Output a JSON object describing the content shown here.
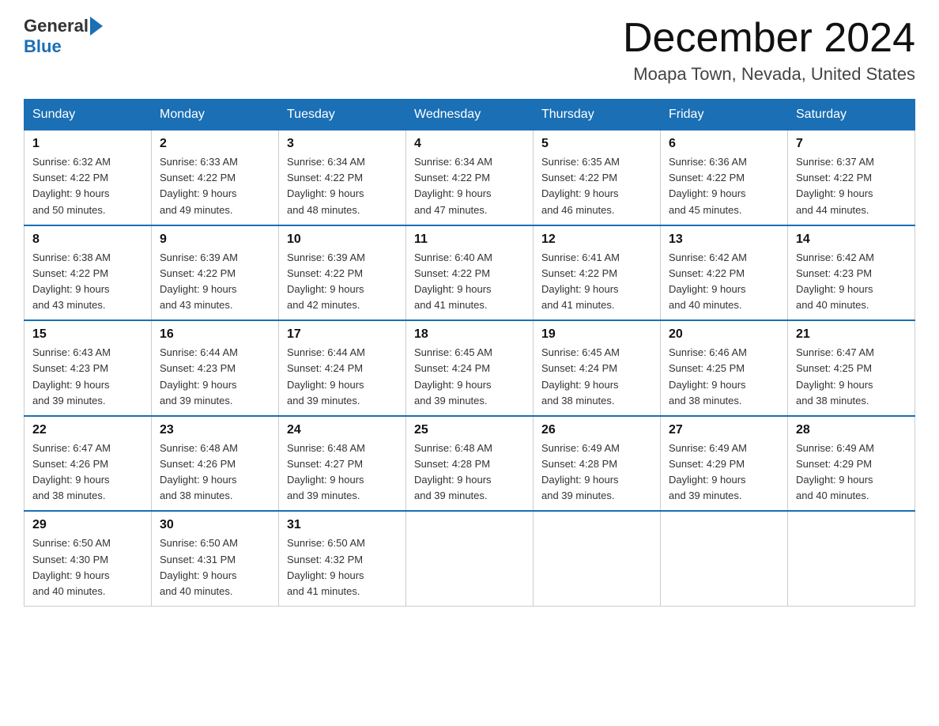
{
  "header": {
    "logo_general": "General",
    "logo_blue": "Blue",
    "month_title": "December 2024",
    "location": "Moapa Town, Nevada, United States"
  },
  "weekdays": [
    "Sunday",
    "Monday",
    "Tuesday",
    "Wednesday",
    "Thursday",
    "Friday",
    "Saturday"
  ],
  "weeks": [
    [
      {
        "day": "1",
        "sunrise": "6:32 AM",
        "sunset": "4:22 PM",
        "daylight": "9 hours and 50 minutes."
      },
      {
        "day": "2",
        "sunrise": "6:33 AM",
        "sunset": "4:22 PM",
        "daylight": "9 hours and 49 minutes."
      },
      {
        "day": "3",
        "sunrise": "6:34 AM",
        "sunset": "4:22 PM",
        "daylight": "9 hours and 48 minutes."
      },
      {
        "day": "4",
        "sunrise": "6:34 AM",
        "sunset": "4:22 PM",
        "daylight": "9 hours and 47 minutes."
      },
      {
        "day": "5",
        "sunrise": "6:35 AM",
        "sunset": "4:22 PM",
        "daylight": "9 hours and 46 minutes."
      },
      {
        "day": "6",
        "sunrise": "6:36 AM",
        "sunset": "4:22 PM",
        "daylight": "9 hours and 45 minutes."
      },
      {
        "day": "7",
        "sunrise": "6:37 AM",
        "sunset": "4:22 PM",
        "daylight": "9 hours and 44 minutes."
      }
    ],
    [
      {
        "day": "8",
        "sunrise": "6:38 AM",
        "sunset": "4:22 PM",
        "daylight": "9 hours and 43 minutes."
      },
      {
        "day": "9",
        "sunrise": "6:39 AM",
        "sunset": "4:22 PM",
        "daylight": "9 hours and 43 minutes."
      },
      {
        "day": "10",
        "sunrise": "6:39 AM",
        "sunset": "4:22 PM",
        "daylight": "9 hours and 42 minutes."
      },
      {
        "day": "11",
        "sunrise": "6:40 AM",
        "sunset": "4:22 PM",
        "daylight": "9 hours and 41 minutes."
      },
      {
        "day": "12",
        "sunrise": "6:41 AM",
        "sunset": "4:22 PM",
        "daylight": "9 hours and 41 minutes."
      },
      {
        "day": "13",
        "sunrise": "6:42 AM",
        "sunset": "4:22 PM",
        "daylight": "9 hours and 40 minutes."
      },
      {
        "day": "14",
        "sunrise": "6:42 AM",
        "sunset": "4:23 PM",
        "daylight": "9 hours and 40 minutes."
      }
    ],
    [
      {
        "day": "15",
        "sunrise": "6:43 AM",
        "sunset": "4:23 PM",
        "daylight": "9 hours and 39 minutes."
      },
      {
        "day": "16",
        "sunrise": "6:44 AM",
        "sunset": "4:23 PM",
        "daylight": "9 hours and 39 minutes."
      },
      {
        "day": "17",
        "sunrise": "6:44 AM",
        "sunset": "4:24 PM",
        "daylight": "9 hours and 39 minutes."
      },
      {
        "day": "18",
        "sunrise": "6:45 AM",
        "sunset": "4:24 PM",
        "daylight": "9 hours and 39 minutes."
      },
      {
        "day": "19",
        "sunrise": "6:45 AM",
        "sunset": "4:24 PM",
        "daylight": "9 hours and 38 minutes."
      },
      {
        "day": "20",
        "sunrise": "6:46 AM",
        "sunset": "4:25 PM",
        "daylight": "9 hours and 38 minutes."
      },
      {
        "day": "21",
        "sunrise": "6:47 AM",
        "sunset": "4:25 PM",
        "daylight": "9 hours and 38 minutes."
      }
    ],
    [
      {
        "day": "22",
        "sunrise": "6:47 AM",
        "sunset": "4:26 PM",
        "daylight": "9 hours and 38 minutes."
      },
      {
        "day": "23",
        "sunrise": "6:48 AM",
        "sunset": "4:26 PM",
        "daylight": "9 hours and 38 minutes."
      },
      {
        "day": "24",
        "sunrise": "6:48 AM",
        "sunset": "4:27 PM",
        "daylight": "9 hours and 39 minutes."
      },
      {
        "day": "25",
        "sunrise": "6:48 AM",
        "sunset": "4:28 PM",
        "daylight": "9 hours and 39 minutes."
      },
      {
        "day": "26",
        "sunrise": "6:49 AM",
        "sunset": "4:28 PM",
        "daylight": "9 hours and 39 minutes."
      },
      {
        "day": "27",
        "sunrise": "6:49 AM",
        "sunset": "4:29 PM",
        "daylight": "9 hours and 39 minutes."
      },
      {
        "day": "28",
        "sunrise": "6:49 AM",
        "sunset": "4:29 PM",
        "daylight": "9 hours and 40 minutes."
      }
    ],
    [
      {
        "day": "29",
        "sunrise": "6:50 AM",
        "sunset": "4:30 PM",
        "daylight": "9 hours and 40 minutes."
      },
      {
        "day": "30",
        "sunrise": "6:50 AM",
        "sunset": "4:31 PM",
        "daylight": "9 hours and 40 minutes."
      },
      {
        "day": "31",
        "sunrise": "6:50 AM",
        "sunset": "4:32 PM",
        "daylight": "9 hours and 41 minutes."
      },
      null,
      null,
      null,
      null
    ]
  ]
}
